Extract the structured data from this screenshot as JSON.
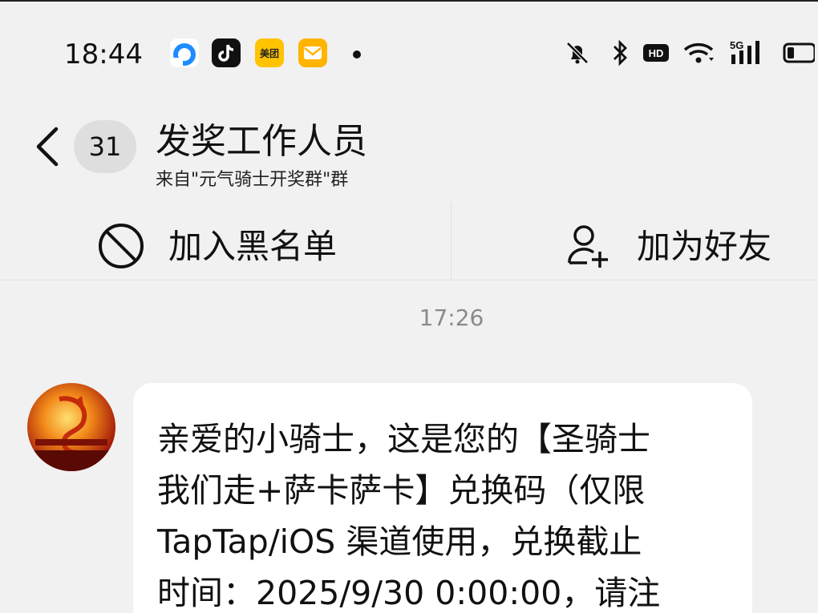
{
  "status_bar": {
    "time": "18:44",
    "meituan_label": "美团",
    "app_icons": [
      "qq-browser-icon",
      "tiktok-icon",
      "meituan-icon",
      "mail-icon"
    ],
    "system_icons": [
      "bell-muted-icon",
      "bluetooth-icon",
      "hd-icon",
      "wifi-icon",
      "signal-5g-icon",
      "battery-icon"
    ],
    "hd_label": "HD",
    "network_label": "5G"
  },
  "header": {
    "unread_count": "31",
    "title": "发奖工作人员",
    "subtitle": "来自\"元气骑士开奖群\"群"
  },
  "actions": {
    "block_label": "加入黑名单",
    "add_friend_label": "加为好友"
  },
  "chat": {
    "timestamp": "17:26",
    "message_lines": [
      "亲爱的小骑士，这是您的【圣骑士",
      "我们走+萨卡萨卡】兑换码（仅限",
      "TapTap/iOS 渠道使用，兑换截止",
      "时间：2025/9/30 0:00:00，请注"
    ]
  },
  "colors": {
    "background": "#f1f1f1",
    "bubble": "#ffffff",
    "badge": "#dedede",
    "timestamp": "#8a8a8a"
  }
}
